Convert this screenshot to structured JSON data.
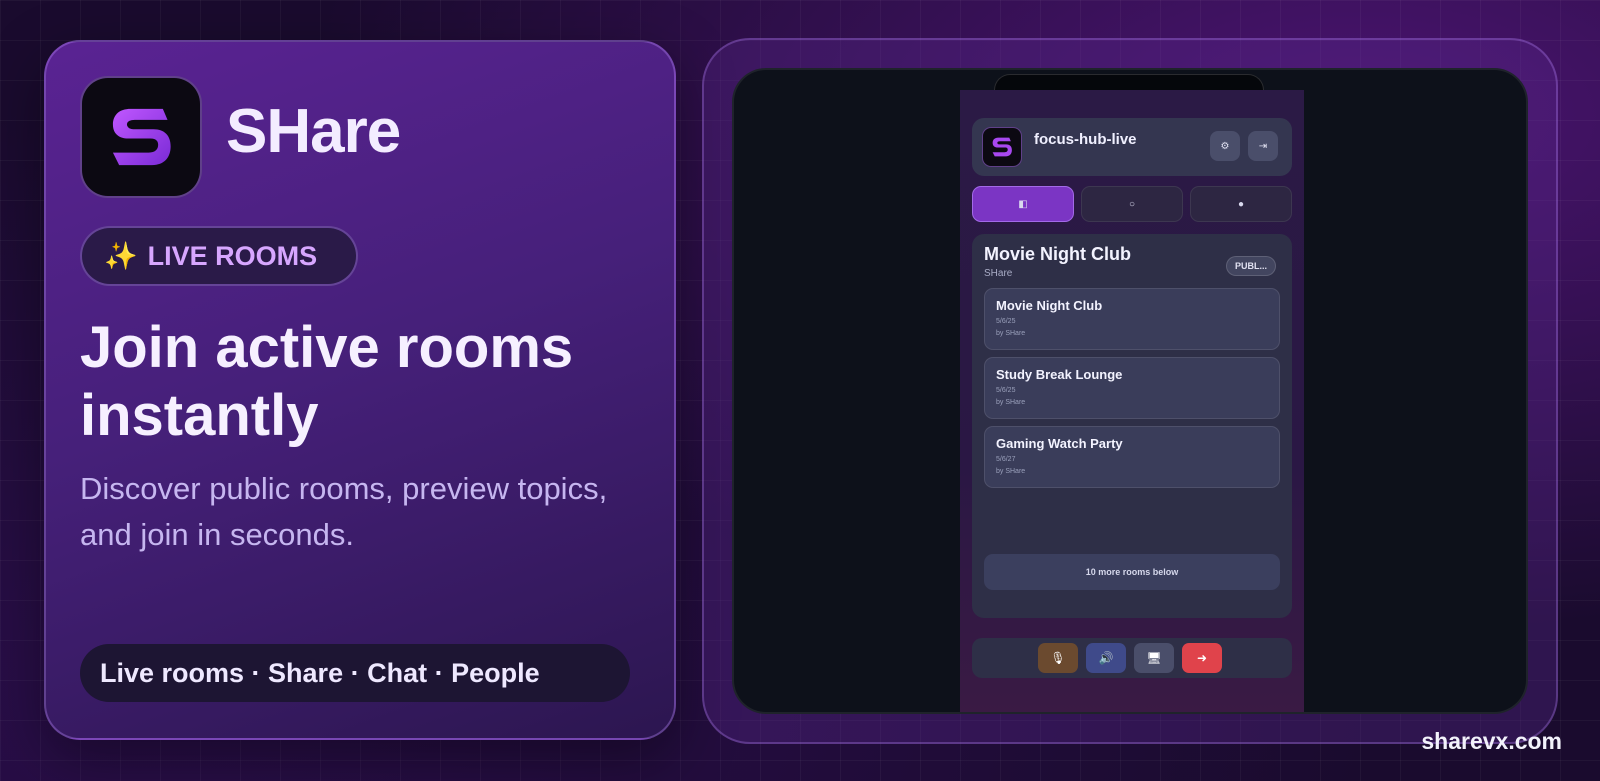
{
  "brand": {
    "app_name": "SHare",
    "badge_sparkle": "✨",
    "badge_label": "LIVE ROOMS",
    "headline": "Join active rooms instantly",
    "subheadline": "Discover public rooms, preview topics, and join in seconds.",
    "features": "Live rooms · Share · Chat · People",
    "url": "sharevx.com"
  },
  "phone": {
    "header_title": "focus-hub-live",
    "header_buttons": [
      {
        "icon": "gear-icon",
        "glyph": "⚙"
      },
      {
        "icon": "exit-icon",
        "glyph": "⇥"
      }
    ],
    "tabs": [
      {
        "icon": "rooms-icon",
        "glyph": "◧",
        "active": true
      },
      {
        "icon": "chat-icon",
        "glyph": "○",
        "active": false
      },
      {
        "icon": "people-icon",
        "glyph": "●",
        "active": false
      }
    ],
    "panel": {
      "title": "Movie Night Club",
      "subtitle": "SHare",
      "visibility": "PUBL...",
      "rooms": [
        {
          "name": "Movie Night Club",
          "meta": "5/6/25",
          "by": "by SHare"
        },
        {
          "name": "Study Break Lounge",
          "meta": "5/6/25",
          "by": "by SHare"
        },
        {
          "name": "Gaming Watch Party",
          "meta": "5/6/27",
          "by": "by SHare"
        }
      ],
      "more_label": "10 more rooms below"
    },
    "controls": [
      {
        "icon": "mic-icon",
        "glyph": "🎙",
        "color": "#6b4a2f"
      },
      {
        "icon": "speaker-icon",
        "glyph": "🔊",
        "color": "#3f4a8a"
      },
      {
        "icon": "screen-icon",
        "glyph": "🖥",
        "color": "#4a4e6a"
      },
      {
        "icon": "leave-icon",
        "glyph": "➜",
        "color": "#e0434b"
      }
    ]
  },
  "colors": {
    "accent": "#7b35c4",
    "leave": "#e0434b",
    "badge_text": "#d7a6ff"
  }
}
